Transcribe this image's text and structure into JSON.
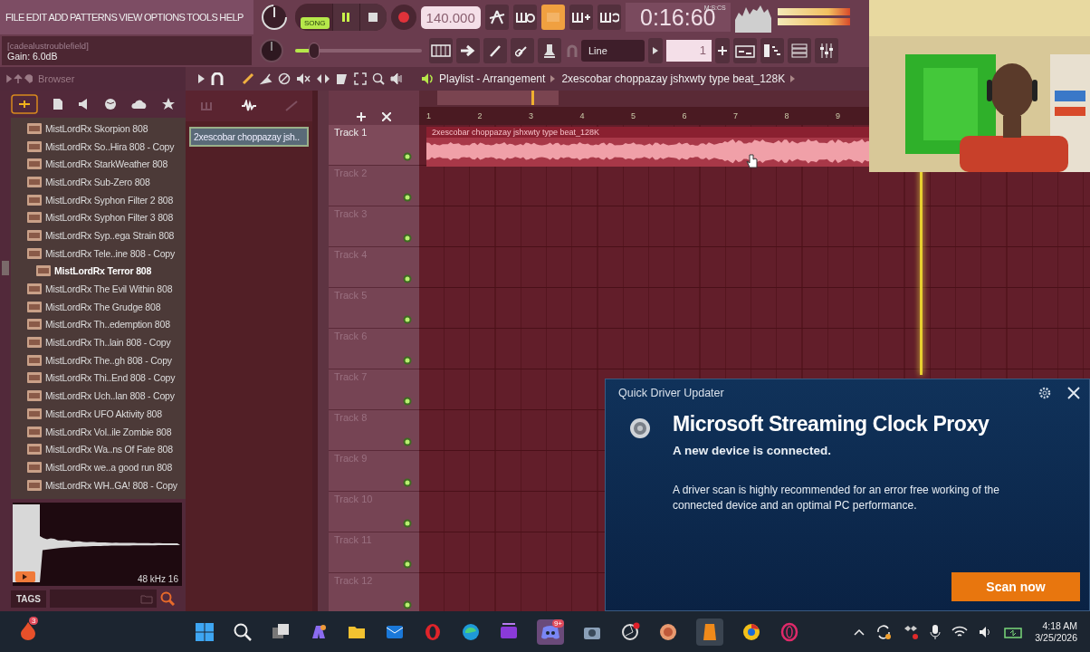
{
  "menu": [
    "FILE",
    "EDIT",
    "ADD",
    "PATTERNS",
    "VIEW",
    "OPTIONS",
    "TOOLS",
    "HELP"
  ],
  "transport": {
    "mode": "SONG",
    "playing": true,
    "tempo": "140.000",
    "time": "0:16:60",
    "time_format": "M:S:CS"
  },
  "hint_panel": {
    "title": "[cadealustroublefield]",
    "text": "Gain:  6.0dB"
  },
  "master_slider": {
    "level": 0.15
  },
  "snap": {
    "value": "Line"
  },
  "pattern": {
    "number": "1"
  },
  "browser": {
    "title": "Browser",
    "items": [
      {
        "name": "MistLordRx Skorpion 808",
        "selected": false
      },
      {
        "name": "MistLordRx So..Hira 808 - Copy",
        "selected": false
      },
      {
        "name": "MistLordRx StarkWeather 808",
        "selected": false
      },
      {
        "name": "MistLordRx Sub-Zero 808",
        "selected": false
      },
      {
        "name": "MistLordRx Syphon Filter 2 808",
        "selected": false
      },
      {
        "name": "MistLordRx Syphon Filter 3 808",
        "selected": false
      },
      {
        "name": "MistLordRx Syp..ega Strain 808",
        "selected": false
      },
      {
        "name": "MistLordRx Tele..ine 808 - Copy",
        "selected": false
      },
      {
        "name": "MistLordRx Terror 808",
        "selected": true
      },
      {
        "name": "MistLordRx The Evil Within 808",
        "selected": false
      },
      {
        "name": "MistLordRx The Grudge 808",
        "selected": false
      },
      {
        "name": "MistLordRx Th..edemption 808",
        "selected": false
      },
      {
        "name": "MistLordRx Th..lain 808 - Copy",
        "selected": false
      },
      {
        "name": "MistLordRx The..gh 808 - Copy",
        "selected": false
      },
      {
        "name": "MistLordRx Thi..End 808 - Copy",
        "selected": false
      },
      {
        "name": "MistLordRx Uch..lan 808 - Copy",
        "selected": false
      },
      {
        "name": "MistLordRx UFO Aktivity 808",
        "selected": false
      },
      {
        "name": "MistLordRx Vol..ile Zombie 808",
        "selected": false
      },
      {
        "name": "MistLordRx Wa..ns Of Fate 808",
        "selected": false
      },
      {
        "name": "MistLordRx we..a good run 808",
        "selected": false
      },
      {
        "name": "MistLordRx WH..GA! 808 - Copy",
        "selected": false
      }
    ],
    "preview_info": "48 kHz 16",
    "tags_label": "TAGS"
  },
  "playlist": {
    "title": "Playlist - Arrangement",
    "song": "2xescobar choppazay jshxwty type beat_128K",
    "picker_item": "2xescobar choppazay jsh..",
    "bars": [
      "1",
      "2",
      "3",
      "4",
      "5",
      "6",
      "7",
      "8",
      "9"
    ],
    "clip": {
      "name": "2xescobar choppazay jshxwty type beat_128K"
    },
    "tracks": [
      {
        "name": "Track 1",
        "highlighted": true
      },
      {
        "name": "Track 2",
        "highlighted": false
      },
      {
        "name": "Track 3",
        "highlighted": false
      },
      {
        "name": "Track 4",
        "highlighted": false
      },
      {
        "name": "Track 5",
        "highlighted": false
      },
      {
        "name": "Track 6",
        "highlighted": false
      },
      {
        "name": "Track 7",
        "highlighted": false
      },
      {
        "name": "Track 8",
        "highlighted": false
      },
      {
        "name": "Track 9",
        "highlighted": false
      },
      {
        "name": "Track 10",
        "highlighted": false
      },
      {
        "name": "Track 11",
        "highlighted": false
      },
      {
        "name": "Track 12",
        "highlighted": false
      }
    ]
  },
  "popup": {
    "app": "Quick Driver Updater",
    "title": "Microsoft Streaming Clock Proxy",
    "subtitle": "A new device is connected.",
    "body": "A driver scan is highly recommended for an error free working of the connected device and an optimal PC performance.",
    "button": "Scan now"
  },
  "taskbar": {
    "start_badge": "3",
    "chat_badge": "9+",
    "time": "4:18 AM",
    "date": "3/25/2026"
  }
}
